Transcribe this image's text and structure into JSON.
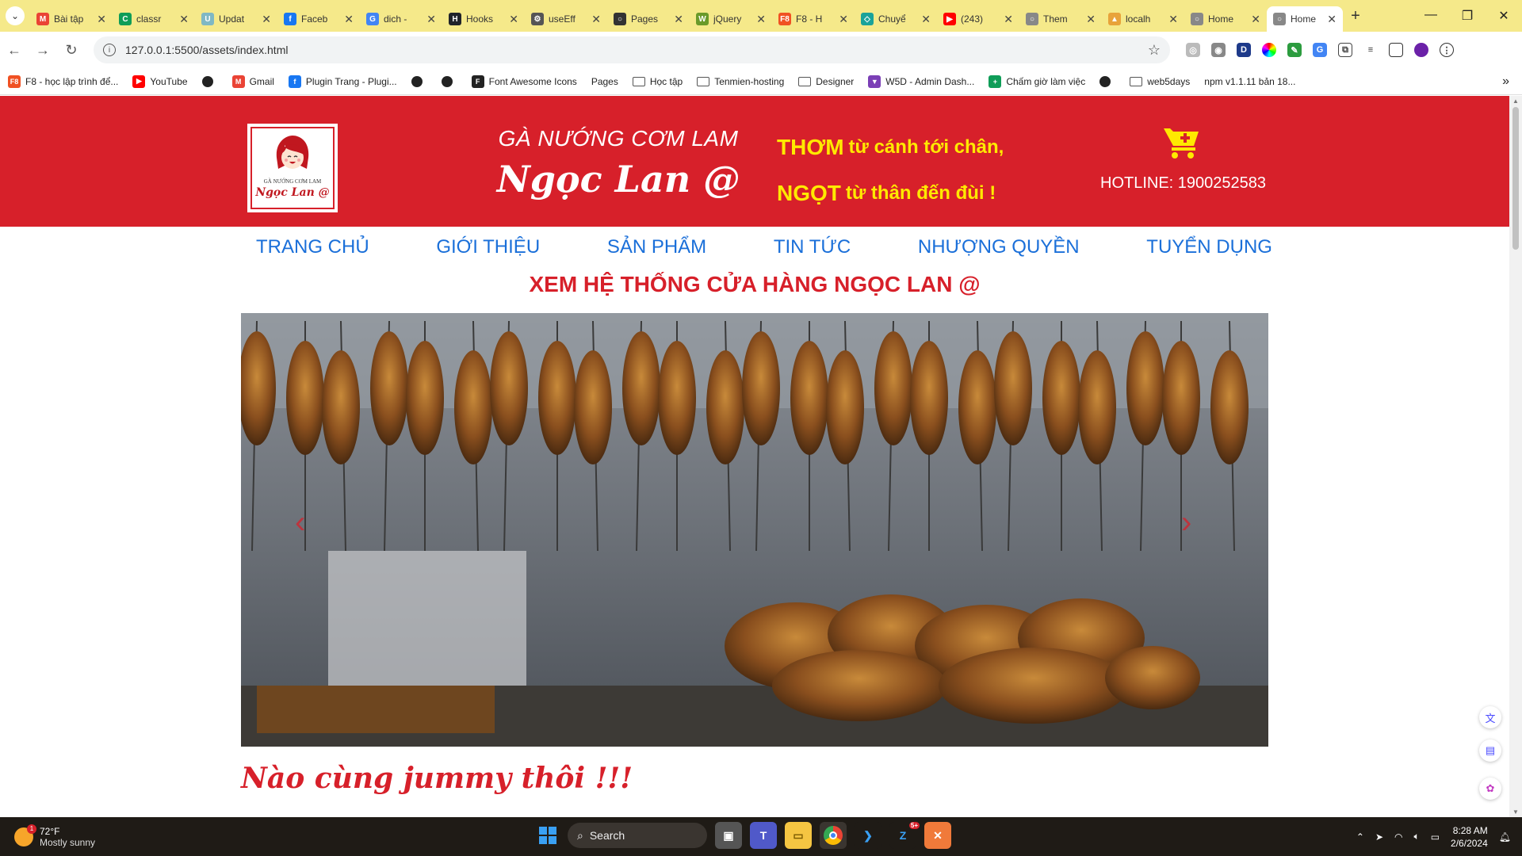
{
  "browser": {
    "tabs": [
      {
        "label": "Bài tập",
        "color": "#ea4335",
        "glyph": "M"
      },
      {
        "label": "classr",
        "color": "#0f9d58",
        "glyph": "C"
      },
      {
        "label": "Updat",
        "color": "#7fb8c4",
        "glyph": "U"
      },
      {
        "label": "Faceb",
        "color": "#1877f2",
        "glyph": "f"
      },
      {
        "label": "dich -",
        "color": "#4285f4",
        "glyph": "G"
      },
      {
        "label": "Hooks",
        "color": "#20232a",
        "glyph": "H"
      },
      {
        "label": "useEff",
        "color": "#555555",
        "glyph": "⚙"
      },
      {
        "label": "Pages",
        "color": "#333333",
        "glyph": "○"
      },
      {
        "label": "jQuery",
        "color": "#6a9a2a",
        "glyph": "W"
      },
      {
        "label": "F8 - H",
        "color": "#f05123",
        "glyph": "F8"
      },
      {
        "label": "Chuyể",
        "color": "#1aa39a",
        "glyph": "◇"
      },
      {
        "label": "(243)",
        "color": "#ff0000",
        "glyph": "▶"
      },
      {
        "label": "Them",
        "color": "#888888",
        "glyph": "○"
      },
      {
        "label": "localh",
        "color": "#e8a33a",
        "glyph": "▲"
      },
      {
        "label": "Home",
        "color": "#888888",
        "glyph": "○"
      },
      {
        "label": "Home",
        "color": "#888888",
        "glyph": "○",
        "active": true
      }
    ],
    "new_tab": "+",
    "url": "127.0.0.1:5500/assets/index.html",
    "bookmarks": [
      {
        "label": "F8 - học lập trình để...",
        "type": "icon",
        "color": "#f05123",
        "glyph": "F8"
      },
      {
        "label": "YouTube",
        "type": "icon",
        "color": "#ff0000",
        "glyph": "▶"
      },
      {
        "label": "",
        "type": "globe"
      },
      {
        "label": "Gmail",
        "type": "icon",
        "color": "#ea4335",
        "glyph": "M"
      },
      {
        "label": "Plugin Trang - Plugi...",
        "type": "icon",
        "color": "#1877f2",
        "glyph": "f"
      },
      {
        "label": "",
        "type": "globe"
      },
      {
        "label": "",
        "type": "globe"
      },
      {
        "label": "Font Awesome Icons",
        "type": "icon",
        "color": "#222222",
        "glyph": "F"
      },
      {
        "label": "Pages",
        "type": "text"
      },
      {
        "label": "Học tập",
        "type": "folder"
      },
      {
        "label": "Tenmien-hosting",
        "type": "folder"
      },
      {
        "label": "Designer",
        "type": "folder"
      },
      {
        "label": "W5D - Admin Dash...",
        "type": "icon",
        "color": "#7b3fb6",
        "glyph": "▼"
      },
      {
        "label": "Chấm giờ làm việc",
        "type": "icon",
        "color": "#0f9d58",
        "glyph": "+"
      },
      {
        "label": "",
        "type": "globe"
      },
      {
        "label": "web5days",
        "type": "folder"
      },
      {
        "label": "npm v1.1.11 bản 18...",
        "type": "text"
      }
    ],
    "bookmarks_more": "»"
  },
  "site": {
    "logo_line1": "GÀ NƯỚNG CƠM LAM",
    "logo_line2": "Ngọc Lan @",
    "brand_sub": "GÀ NƯỚNG CƠM LAM",
    "brand_main": "Ngọc Lan @",
    "slogan": [
      {
        "big": "THƠM",
        "rest": "từ cánh tới chân,"
      },
      {
        "big": "NGỌT",
        "rest": "từ thân đến đùi !"
      }
    ],
    "hotline": "HOTLINE: 1900252583",
    "nav": [
      "TRANG CHỦ",
      "GIỚI THIỆU",
      "SẢN PHẨM",
      "TIN TỨC",
      "NHƯỢNG QUYỀN",
      "TUYỂN DỤNG"
    ],
    "store_link": "XEM HỆ THỐNG CỬA HÀNG NGỌC LAN @",
    "slider_prev": "‹",
    "slider_next": "›",
    "section_title": "Nào cùng jummy thôi !!!",
    "colors": {
      "primary": "#d7202a",
      "accent": "#ffe900",
      "nav": "#1a6fd9"
    }
  },
  "taskbar": {
    "weather_temp": "72°F",
    "weather_desc": "Mostly sunny",
    "weather_badge": "1",
    "search": "Search",
    "time": "8:28 AM",
    "date": "2/6/2024",
    "badge_count": "5+"
  }
}
